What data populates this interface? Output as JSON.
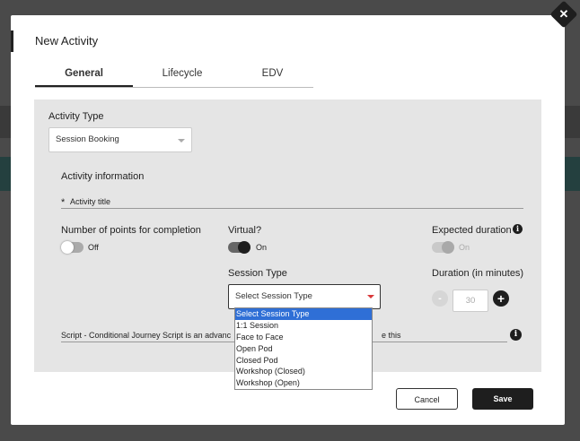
{
  "modal": {
    "title": "New Activity",
    "close_label": "✕"
  },
  "tabs": [
    {
      "label": "General",
      "active": true
    },
    {
      "label": "Lifecycle",
      "active": false
    },
    {
      "label": "EDV",
      "active": false
    }
  ],
  "general": {
    "activity_type": {
      "label": "Activity Type",
      "value": "Session Booking"
    },
    "activity_information_heading": "Activity information",
    "activity_title": {
      "required_mark": "*",
      "placeholder": "Activity title"
    },
    "points_for_completion": {
      "label": "Number of points for completion",
      "toggle_state": "Off"
    },
    "virtual": {
      "label": "Virtual?",
      "toggle_state": "On"
    },
    "expected_duration": {
      "label": "Expected duration",
      "toggle_state": "On"
    },
    "session_type": {
      "label": "Session Type",
      "value": "Select Session Type",
      "options": [
        "Select Session Type",
        "1:1 Session",
        "Face to Face",
        "Open Pod",
        "Closed Pod",
        "Workshop (Closed)",
        "Workshop (Open)"
      ],
      "selected_index": 0
    },
    "duration_minutes": {
      "label": "Duration (in minutes)",
      "value": "30",
      "decrement": "-",
      "increment": "+"
    },
    "script": {
      "text_start": "Script - Conditional Journey Script is an advanc",
      "text_end": "e this"
    }
  },
  "footer": {
    "cancel_label": "Cancel",
    "save_label": "Save"
  },
  "colors": {
    "accent_dark": "#1e1e1e",
    "selection_blue": "#2f6fd6",
    "caret_red": "#d9383a",
    "panel_gray": "#e5e5e5"
  }
}
